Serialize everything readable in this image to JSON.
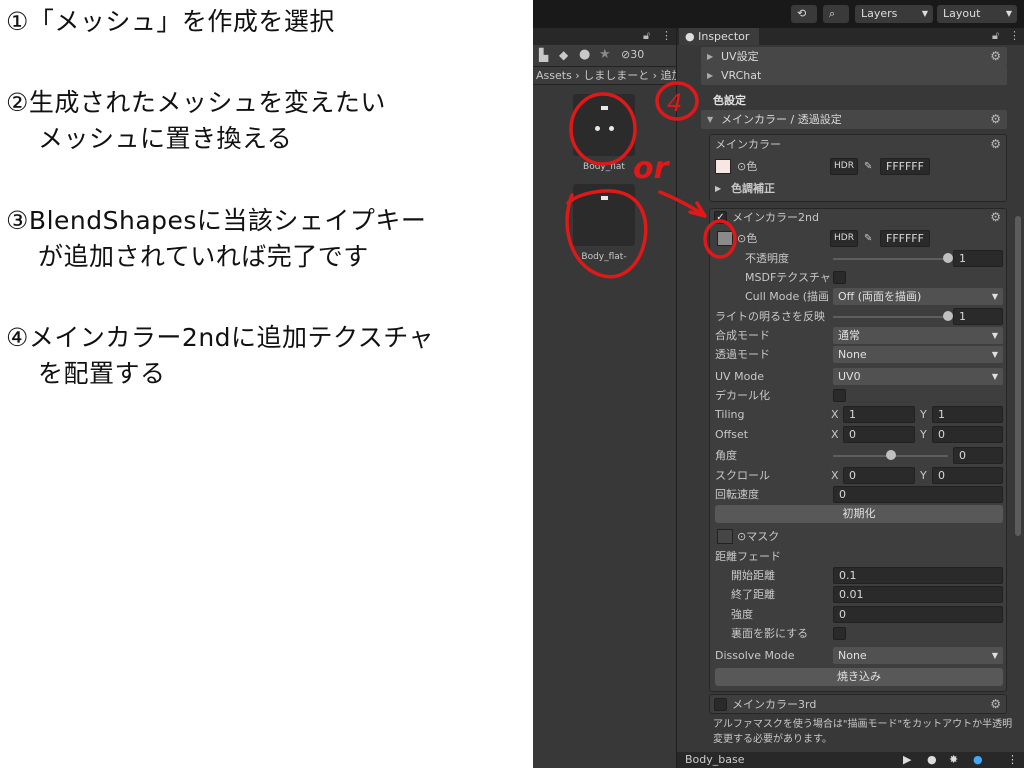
{
  "notes": {
    "step1": "①「メッシュ」を作成を選択",
    "step2_line1": "②生成されたメッシュを変えたい",
    "step2_line2": "メッシュに置き換える",
    "step3_line1": "③BlendShapesに当該シェイプキー",
    "step3_line2": "が追加されていれば完了です",
    "step4_line1": "④メインカラー2ndに追加テクスチャ",
    "step4_line2": "を配置する"
  },
  "toolbar": {
    "layers": "Layers",
    "layout": "Layout"
  },
  "project": {
    "visibility_count": "30",
    "breadcrumb": "Assets › しましまーと › 追加",
    "assets": [
      {
        "label": "Body_flat"
      },
      {
        "label": "Body_flat-"
      }
    ]
  },
  "inspector": {
    "tab": "Inspector",
    "uv_settings": "UV設定",
    "vrchat": "VRChat",
    "color_settings": "色設定",
    "main_color_section": "メインカラー / 透過設定",
    "main_color": "メインカラー",
    "color_label": "色",
    "hdr": "HDR",
    "main_hex": "FFFFFF",
    "color_correction": "色調補正",
    "main2nd": {
      "title": "メインカラー2nd",
      "color_label": "色",
      "hex": "FFFFFF",
      "opacity_label": "不透明度",
      "opacity_value": "1",
      "opacity": 1,
      "msdf_label": "MSDFテクスチャ",
      "cull_label": "Cull Mode (描画",
      "cull_value": "Off (両面を描画)",
      "light_label": "ライトの明るさを反映",
      "light_value": "1",
      "light": 1,
      "blend_label": "合成モード",
      "blend_value": "通常",
      "alpha_label": "透過モード",
      "alpha_value": "None",
      "uvmode_label": "UV Mode",
      "uvmode_value": "UV0",
      "decal_label": "デカール化",
      "tiling_label": "Tiling",
      "tiling_x": "1",
      "tiling_y": "1",
      "offset_label": "Offset",
      "offset_x": "0",
      "offset_y": "0",
      "angle_label": "角度",
      "angle_value": "0",
      "angle": 0.5,
      "scroll_label": "スクロール",
      "scroll_x": "0",
      "scroll_y": "0",
      "rotation_label": "回転速度",
      "rotation_value": "0",
      "reset_button": "初期化",
      "mask_label": "マスク",
      "fade_label": "距離フェード",
      "start_label": "開始距離",
      "start_value": "0.1",
      "end_label": "終了距離",
      "end_value": "0.01",
      "strength_label": "強度",
      "strength_value": "0",
      "backface_label": "裏面を影にする",
      "dissolve_label": "Dissolve Mode",
      "dissolve_value": "None",
      "bake_button": "焼き込み"
    },
    "main3rd_title": "メインカラー3rd",
    "warning_line1": "アルファマスクを使う場合は\"描画モード\"をカットアウトか半透明に",
    "warning_line2": "変更する必要があります。",
    "footer_name": "Body_base",
    "axis_x": "X",
    "axis_y": "Y"
  },
  "annotation": {
    "circle_number": "4",
    "handwritten_or": "or"
  },
  "colors": {
    "annotation": "#e01818",
    "main_swatch": "#f7e6e2"
  }
}
